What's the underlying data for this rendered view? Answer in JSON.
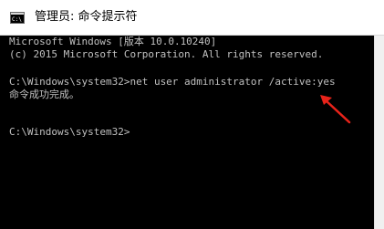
{
  "window": {
    "title": "管理员: 命令提示符"
  },
  "console": {
    "lines": [
      "Microsoft Windows [版本 10.0.10240]",
      "(c) 2015 Microsoft Corporation. All rights reserved.",
      "C:\\Windows\\system32>net user administrator /active:yes",
      "命令成功完成。",
      "C:\\Windows\\system32>"
    ]
  },
  "icons": {
    "app": "cmd-icon",
    "annotation": "red-arrow-icon"
  },
  "colors": {
    "console_background": "#000000",
    "console_text": "#c0c0c0",
    "annotation_arrow": "#e8231a"
  }
}
